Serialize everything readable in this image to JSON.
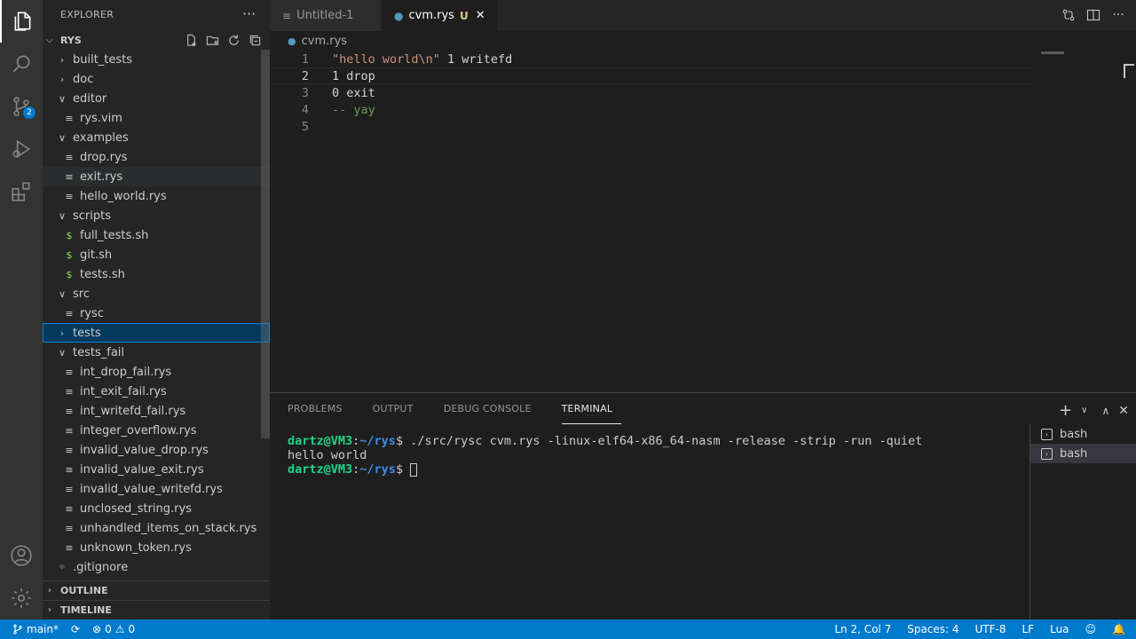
{
  "sidebar": {
    "title": "EXPLORER",
    "root": "RYS",
    "tree": [
      {
        "label": "built_tests",
        "type": "folder",
        "open": false,
        "depth": 1
      },
      {
        "label": "doc",
        "type": "folder",
        "open": false,
        "depth": 1
      },
      {
        "label": "editor",
        "type": "folder",
        "open": true,
        "depth": 1
      },
      {
        "label": "rys.vim",
        "type": "file",
        "depth": 2,
        "icon": "lines"
      },
      {
        "label": "examples",
        "type": "folder",
        "open": true,
        "depth": 1
      },
      {
        "label": "drop.rys",
        "type": "file",
        "depth": 2,
        "icon": "lines"
      },
      {
        "label": "exit.rys",
        "type": "file",
        "depth": 2,
        "icon": "lines"
      },
      {
        "label": "hello_world.rys",
        "type": "file",
        "depth": 2,
        "icon": "lines"
      },
      {
        "label": "scripts",
        "type": "folder",
        "open": true,
        "depth": 1
      },
      {
        "label": "full_tests.sh",
        "type": "file",
        "depth": 2,
        "icon": "dollar"
      },
      {
        "label": "git.sh",
        "type": "file",
        "depth": 2,
        "icon": "dollar"
      },
      {
        "label": "tests.sh",
        "type": "file",
        "depth": 2,
        "icon": "dollar"
      },
      {
        "label": "src",
        "type": "folder",
        "open": true,
        "depth": 1
      },
      {
        "label": "rysc",
        "type": "file",
        "depth": 2,
        "icon": "lines"
      },
      {
        "label": "tests",
        "type": "folder",
        "open": false,
        "depth": 1
      },
      {
        "label": "tests_fail",
        "type": "folder",
        "open": true,
        "depth": 1
      },
      {
        "label": "int_drop_fail.rys",
        "type": "file",
        "depth": 2,
        "icon": "lines"
      },
      {
        "label": "int_exit_fail.rys",
        "type": "file",
        "depth": 2,
        "icon": "lines"
      },
      {
        "label": "int_writefd_fail.rys",
        "type": "file",
        "depth": 2,
        "icon": "lines"
      },
      {
        "label": "integer_overflow.rys",
        "type": "file",
        "depth": 2,
        "icon": "lines"
      },
      {
        "label": "invalid_value_drop.rys",
        "type": "file",
        "depth": 2,
        "icon": "lines"
      },
      {
        "label": "invalid_value_exit.rys",
        "type": "file",
        "depth": 2,
        "icon": "lines"
      },
      {
        "label": "invalid_value_writefd.rys",
        "type": "file",
        "depth": 2,
        "icon": "lines"
      },
      {
        "label": "unclosed_string.rys",
        "type": "file",
        "depth": 2,
        "icon": "lines"
      },
      {
        "label": "unhandled_items_on_stack.rys",
        "type": "file",
        "depth": 2,
        "icon": "lines"
      },
      {
        "label": "unknown_token.rys",
        "type": "file",
        "depth": 2,
        "icon": "lines"
      },
      {
        "label": ".gitignore",
        "type": "file",
        "depth": 1,
        "icon": "diamond"
      }
    ],
    "outline": "OUTLINE",
    "timeline": "TIMELINE"
  },
  "activity": {
    "scm_badge": "2"
  },
  "tabs": [
    {
      "label": "Untitled-1",
      "active": false
    },
    {
      "label": "cvm.rys",
      "active": true,
      "modified": "U"
    }
  ],
  "breadcrumb": "cvm.rys",
  "editor": {
    "lines": [
      {
        "n": "1",
        "tokens": [
          {
            "t": "\"hello world\\n\"",
            "c": "str"
          },
          {
            "t": " 1 writefd",
            "c": "def"
          }
        ]
      },
      {
        "n": "2",
        "tokens": [
          {
            "t": "1 drop",
            "c": "def"
          }
        ]
      },
      {
        "n": "3",
        "tokens": [
          {
            "t": "0 exit",
            "c": "def"
          }
        ]
      },
      {
        "n": "4",
        "tokens": [
          {
            "t": "-- yay",
            "c": "cmt"
          }
        ]
      },
      {
        "n": "5",
        "tokens": []
      }
    ]
  },
  "panel": {
    "tabs": [
      "PROBLEMS",
      "OUTPUT",
      "DEBUG CONSOLE",
      "TERMINAL"
    ],
    "terminal": {
      "user": "dartz@VM3",
      "path": "~/rys",
      "command": "$ ./src/rysc cvm.rys -linux-elf64-x86_64-nasm -release -strip -run -quiet",
      "output": "hello world",
      "prompt_suffix": "$ "
    },
    "terminals": [
      "bash",
      "bash"
    ]
  },
  "status": {
    "branch": "main*",
    "errors": "0",
    "warnings": "0",
    "position": "Ln 2, Col 7",
    "spaces": "Spaces: 4",
    "encoding": "UTF-8",
    "eol": "LF",
    "language": "Lua"
  }
}
